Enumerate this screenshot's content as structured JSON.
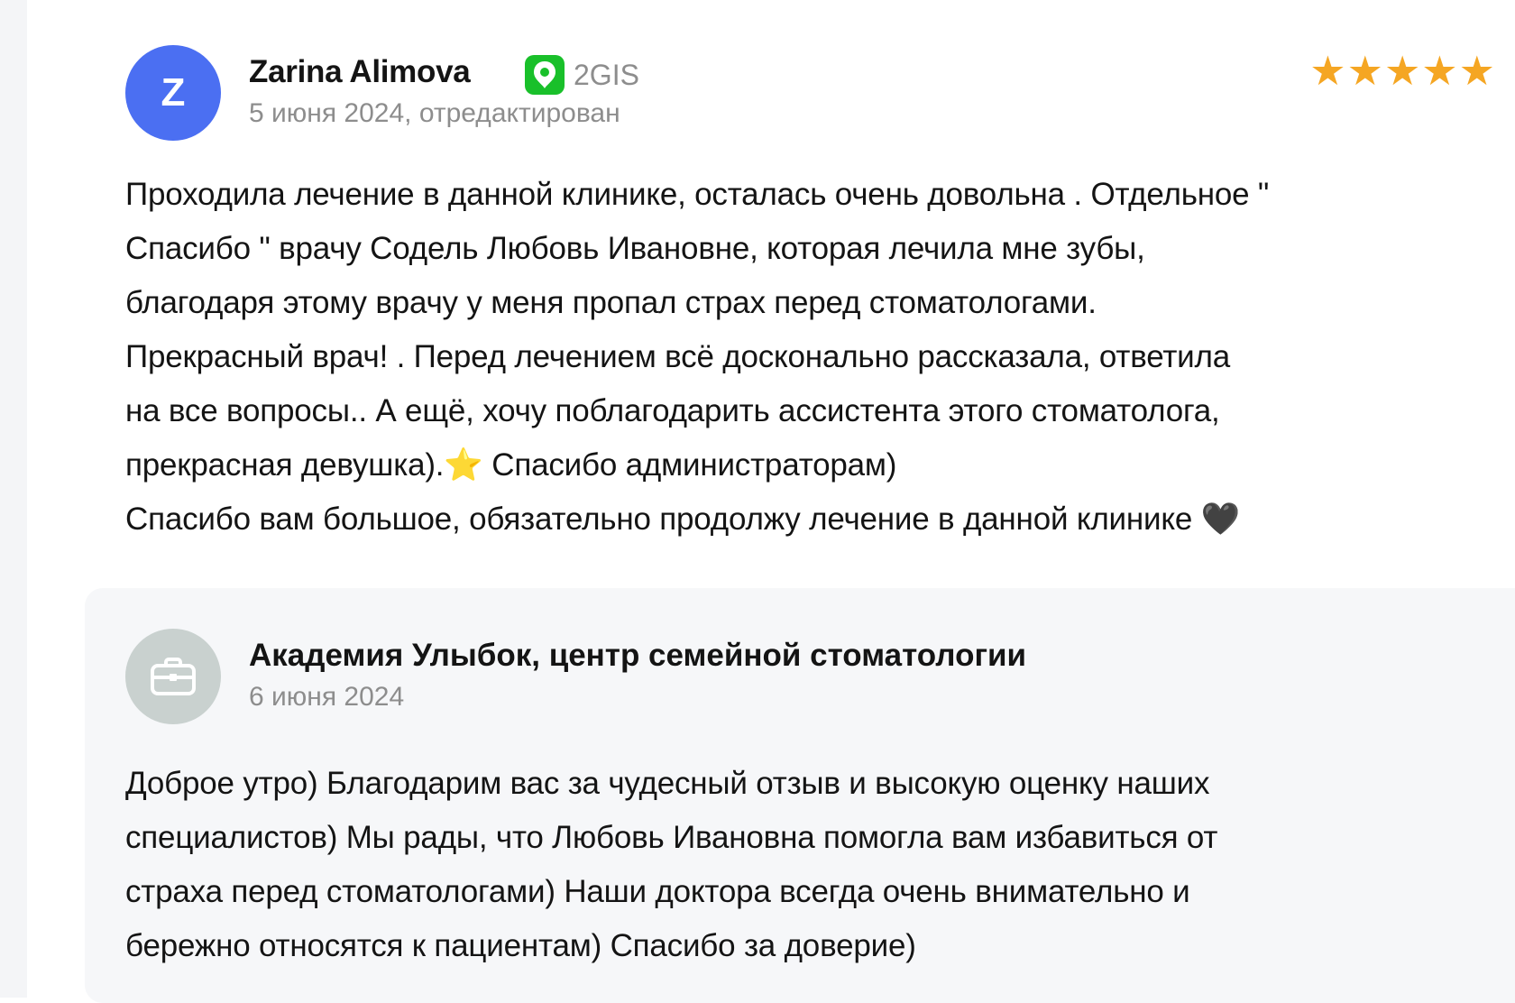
{
  "review": {
    "avatar_letter": "Z",
    "avatar_color": "#4b6ff2",
    "author": "Zarina Alimova",
    "source_label": "2GIS",
    "source_icon": "2gis-logo-icon",
    "source_color": "#19c02a",
    "date": "5 июня 2024, отредактирован",
    "rating": 5,
    "rating_max": 5,
    "stars": "★★★★★",
    "star_color": "#f5a623",
    "text_lines": [
      "Проходила лечение в данной клинике, осталась очень довольна . Отдельное \"",
      "Спасибо \" врачу Содель Любовь Ивановне, которая лечила мне зубы,",
      "благодаря этому врачу у меня пропал страх перед стоматологами.",
      "Прекрасный врач! . Перед лечением всё досконально рассказала, ответила",
      "на все вопросы.. А ещё, хочу поблагодарить ассистента этого стоматолога,",
      "прекрасная девушка).",
      "⭐",
      " Спасибо администраторам)",
      "Спасибо вам большое, обязательно продолжу лечение в данной клинике ",
      "🖤"
    ]
  },
  "reply": {
    "org_icon": "briefcase-icon",
    "org_name": "Академия Улыбок, центр семейной стоматологии",
    "date": "6 июня 2024",
    "text_lines": [
      "Доброе утро) Благодарим вас за чудесный отзыв и высокую оценку наших",
      "специалистов) Мы рады, что Любовь Ивановна помогла вам избавиться от",
      "страха перед стоматологами) Наши доктора всегда очень внимательно и",
      "бережно относятся к пациентам) Спасибо за доверие)"
    ]
  }
}
